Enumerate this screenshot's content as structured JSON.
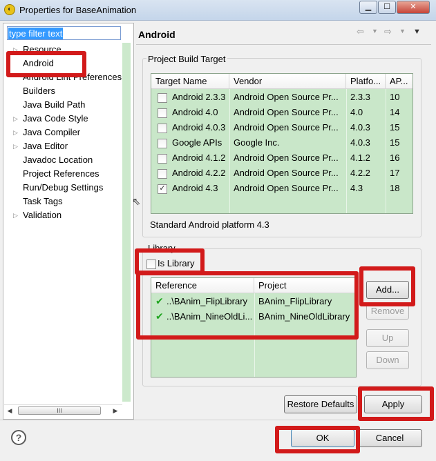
{
  "window": {
    "title": "Properties for BaseAnimation",
    "app_icon": "eclipse-icon",
    "controls": [
      "minimize",
      "maximize",
      "close"
    ]
  },
  "sidebar": {
    "filter_placeholder": "type filter text",
    "items": [
      {
        "label": "Resource",
        "expandable": true
      },
      {
        "label": "Android",
        "expandable": false,
        "selected": true
      },
      {
        "label": "Android Lint Preferences",
        "expandable": false
      },
      {
        "label": "Builders",
        "expandable": false
      },
      {
        "label": "Java Build Path",
        "expandable": false
      },
      {
        "label": "Java Code Style",
        "expandable": true
      },
      {
        "label": "Java Compiler",
        "expandable": true
      },
      {
        "label": "Java Editor",
        "expandable": true
      },
      {
        "label": "Javadoc Location",
        "expandable": false
      },
      {
        "label": "Project References",
        "expandable": false
      },
      {
        "label": "Run/Debug Settings",
        "expandable": false
      },
      {
        "label": "Task Tags",
        "expandable": false
      },
      {
        "label": "Validation",
        "expandable": true
      }
    ],
    "scroll_label": "III"
  },
  "page": {
    "title": "Android",
    "build_target": {
      "group_title": "Project Build Target",
      "columns": [
        "Target Name",
        "Vendor",
        "Platfo...",
        "AP..."
      ],
      "rows": [
        {
          "checked": false,
          "name": "Android 2.3.3",
          "vendor": "Android Open Source Pr...",
          "platform": "2.3.3",
          "api": "10"
        },
        {
          "checked": false,
          "name": "Android 4.0",
          "vendor": "Android Open Source Pr...",
          "platform": "4.0",
          "api": "14"
        },
        {
          "checked": false,
          "name": "Android 4.0.3",
          "vendor": "Android Open Source Pr...",
          "platform": "4.0.3",
          "api": "15"
        },
        {
          "checked": false,
          "name": "Google APIs",
          "vendor": "Google Inc.",
          "platform": "4.0.3",
          "api": "15"
        },
        {
          "checked": false,
          "name": "Android 4.1.2",
          "vendor": "Android Open Source Pr...",
          "platform": "4.1.2",
          "api": "16"
        },
        {
          "checked": false,
          "name": "Android 4.2.2",
          "vendor": "Android Open Source Pr...",
          "platform": "4.2.2",
          "api": "17"
        },
        {
          "checked": true,
          "name": "Android 4.3",
          "vendor": "Android Open Source Pr...",
          "platform": "4.3",
          "api": "18"
        }
      ],
      "description": "Standard Android platform 4.3"
    },
    "library": {
      "group_title": "Library",
      "is_library_label": "Is Library",
      "is_library_checked": false,
      "columns": [
        "Reference",
        "Project"
      ],
      "rows": [
        {
          "reference": "..\\BAnim_FlipLibrary",
          "project": "BAnim_FlipLibrary"
        },
        {
          "reference": "..\\BAnim_NineOldLi...",
          "project": "BAnim_NineOldLibrary"
        }
      ],
      "buttons": {
        "add": "Add...",
        "remove": "Remove",
        "up": "Up",
        "down": "Down"
      }
    },
    "restore_defaults": "Restore Defaults",
    "apply": "Apply"
  },
  "footer": {
    "ok": "OK",
    "cancel": "Cancel",
    "help_symbol": "?"
  },
  "colors": {
    "table_bg": "#c9e7c9",
    "highlight": "#d21a1a",
    "selection": "#3399ff"
  }
}
